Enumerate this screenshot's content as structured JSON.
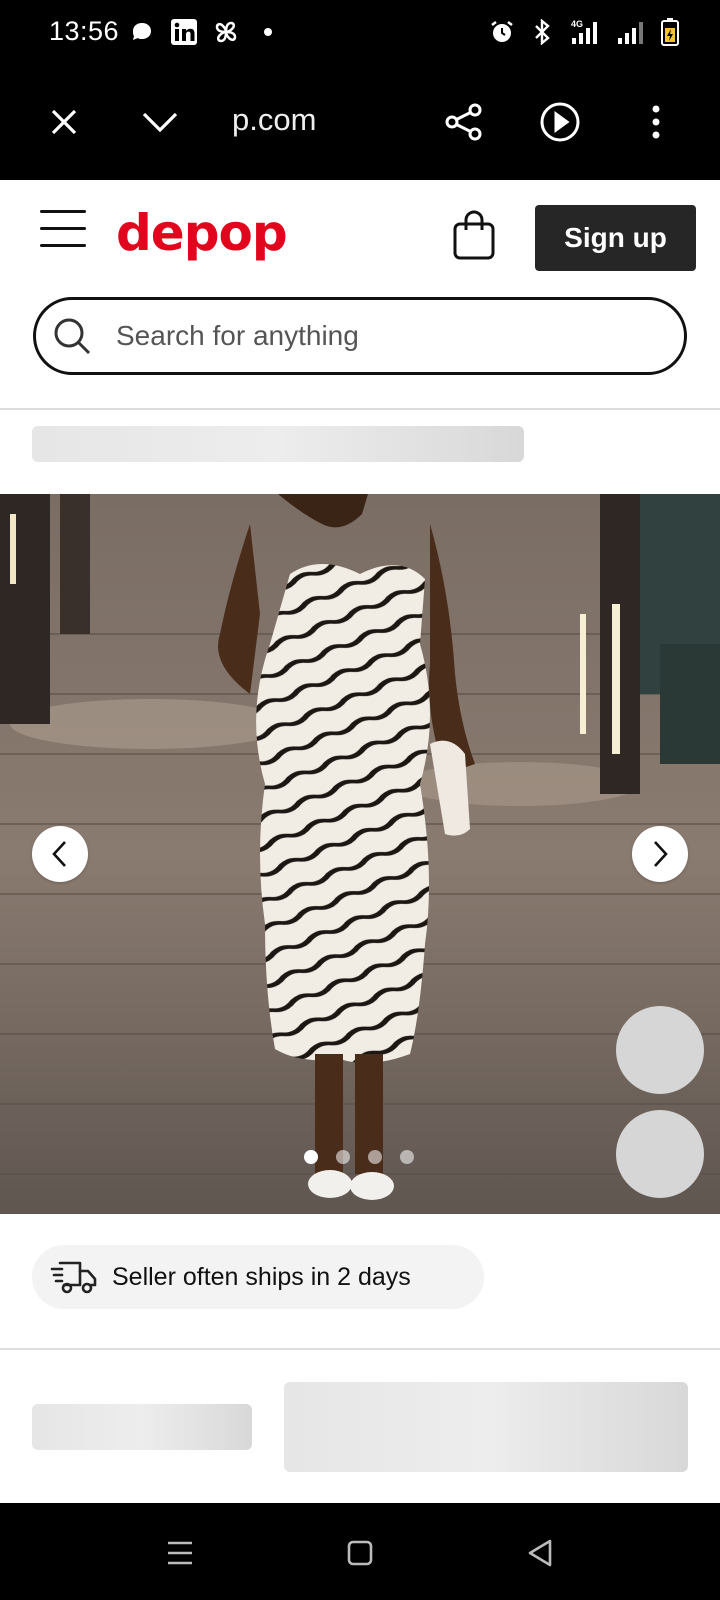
{
  "status_bar": {
    "time": "13:56",
    "left_icons": [
      "threads-icon",
      "linkedin-icon",
      "pinwheel-icon",
      "dot-icon"
    ],
    "right_icons": [
      "alarm-icon",
      "bluetooth-icon",
      "4g-signal-icon",
      "signal-icon",
      "battery-icon"
    ],
    "network_label": "4G"
  },
  "browser_bar": {
    "url": "p.com",
    "icons": [
      "close-icon",
      "chevron-down-icon",
      "share-icon",
      "play-icon",
      "more-icon"
    ]
  },
  "header": {
    "logo": "depop",
    "signup_label": "Sign up",
    "brand_color": "#e1061d"
  },
  "search": {
    "placeholder": "Search for anything"
  },
  "product": {
    "image_count": 4,
    "active_image": 1
  },
  "shipping": {
    "text": "Seller often ships in 2 days"
  }
}
